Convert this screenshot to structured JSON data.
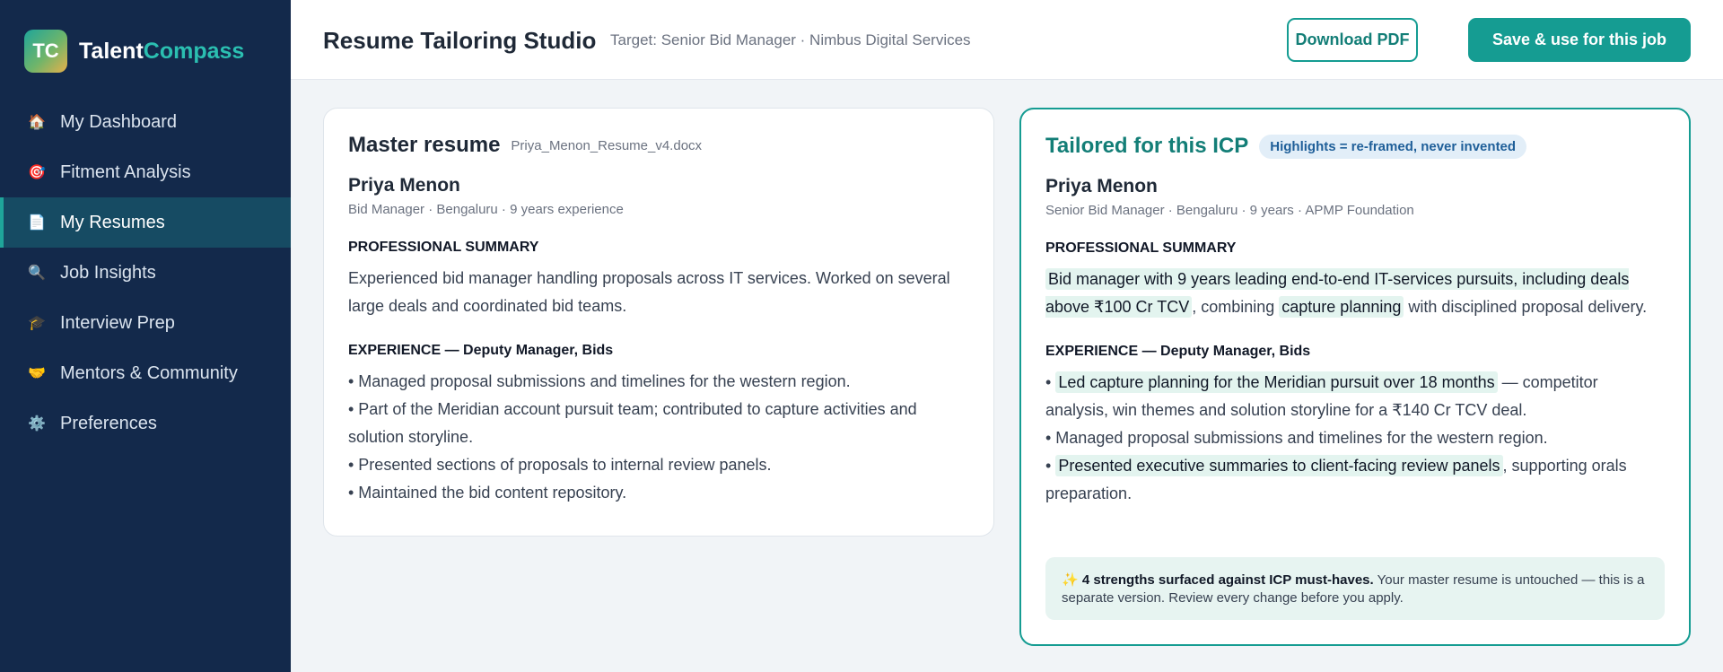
{
  "brand": {
    "initials": "TC",
    "name_part1": "Talent",
    "name_part2": "Compass"
  },
  "sidebar": {
    "items": [
      {
        "label": "My Dashboard",
        "icon": "🏠"
      },
      {
        "label": "Fitment Analysis",
        "icon": "🎯"
      },
      {
        "label": "My Resumes",
        "icon": "📄",
        "active": true
      },
      {
        "label": "Job Insights",
        "icon": "🔍"
      },
      {
        "label": "Interview Prep",
        "icon": "🎓"
      },
      {
        "label": "Mentors & Community",
        "icon": "🤝"
      },
      {
        "label": "Preferences",
        "icon": "⚙️"
      }
    ]
  },
  "header": {
    "title": "Resume Tailoring Studio",
    "target": "Target: Senior Bid Manager · Nimbus Digital Services",
    "download_label": "Download PDF",
    "save_label": "Save & use for this job"
  },
  "master": {
    "title": "Master resume",
    "filename": "Priya_Menon_Resume_v4.docx",
    "name": "Priya Menon",
    "meta": "Bid Manager · Bengaluru · 9 years experience",
    "summary_heading": "PROFESSIONAL SUMMARY",
    "summary": "Experienced bid manager handling proposals across IT services. Worked on several large deals and coordinated bid teams.",
    "experience_heading": "EXPERIENCE — Deputy Manager, Bids",
    "bullets": [
      "• Managed proposal submissions and timelines for the western region.",
      "• Part of the Meridian account pursuit team; contributed to capture activities and solution storyline.",
      "• Presented sections of proposals to internal review panels.",
      "• Maintained the bid content repository."
    ]
  },
  "tailored": {
    "title": "Tailored for this ICP",
    "badge": "Highlights = re-framed, never invented",
    "name": "Priya Menon",
    "meta": "Senior Bid Manager · Bengaluru · 9 years · APMP Foundation",
    "summary_heading": "PROFESSIONAL SUMMARY",
    "summary_hl1": "Bid manager with 9 years leading end-to-end IT-services pursuits, including deals above ₹100 Cr TCV",
    "summary_mid": ", combining ",
    "summary_hl2": "capture planning",
    "summary_end": " with disciplined proposal delivery.",
    "experience_heading": "EXPERIENCE — Deputy Manager, Bids",
    "bullet_prefix": "• ",
    "b1_hl": "Led capture planning for the Meridian pursuit over 18 months",
    "b1_rest": " — competitor analysis, win themes and solution storyline for a ₹140 Cr TCV deal.",
    "b2": "• Managed proposal submissions and timelines for the western region.",
    "b3_hl": "Presented executive summaries to client-facing review panels",
    "b3_rest": ", supporting orals preparation.",
    "note_icon": "✨",
    "note_bold": "4 strengths surfaced against ICP must-haves.",
    "note_text": " Your master resume is untouched — this is a separate version. Review every change before you apply."
  },
  "colors": {
    "sidebar": "#13294b",
    "accent": "#159c92",
    "highlight": "#e3f4ef"
  }
}
